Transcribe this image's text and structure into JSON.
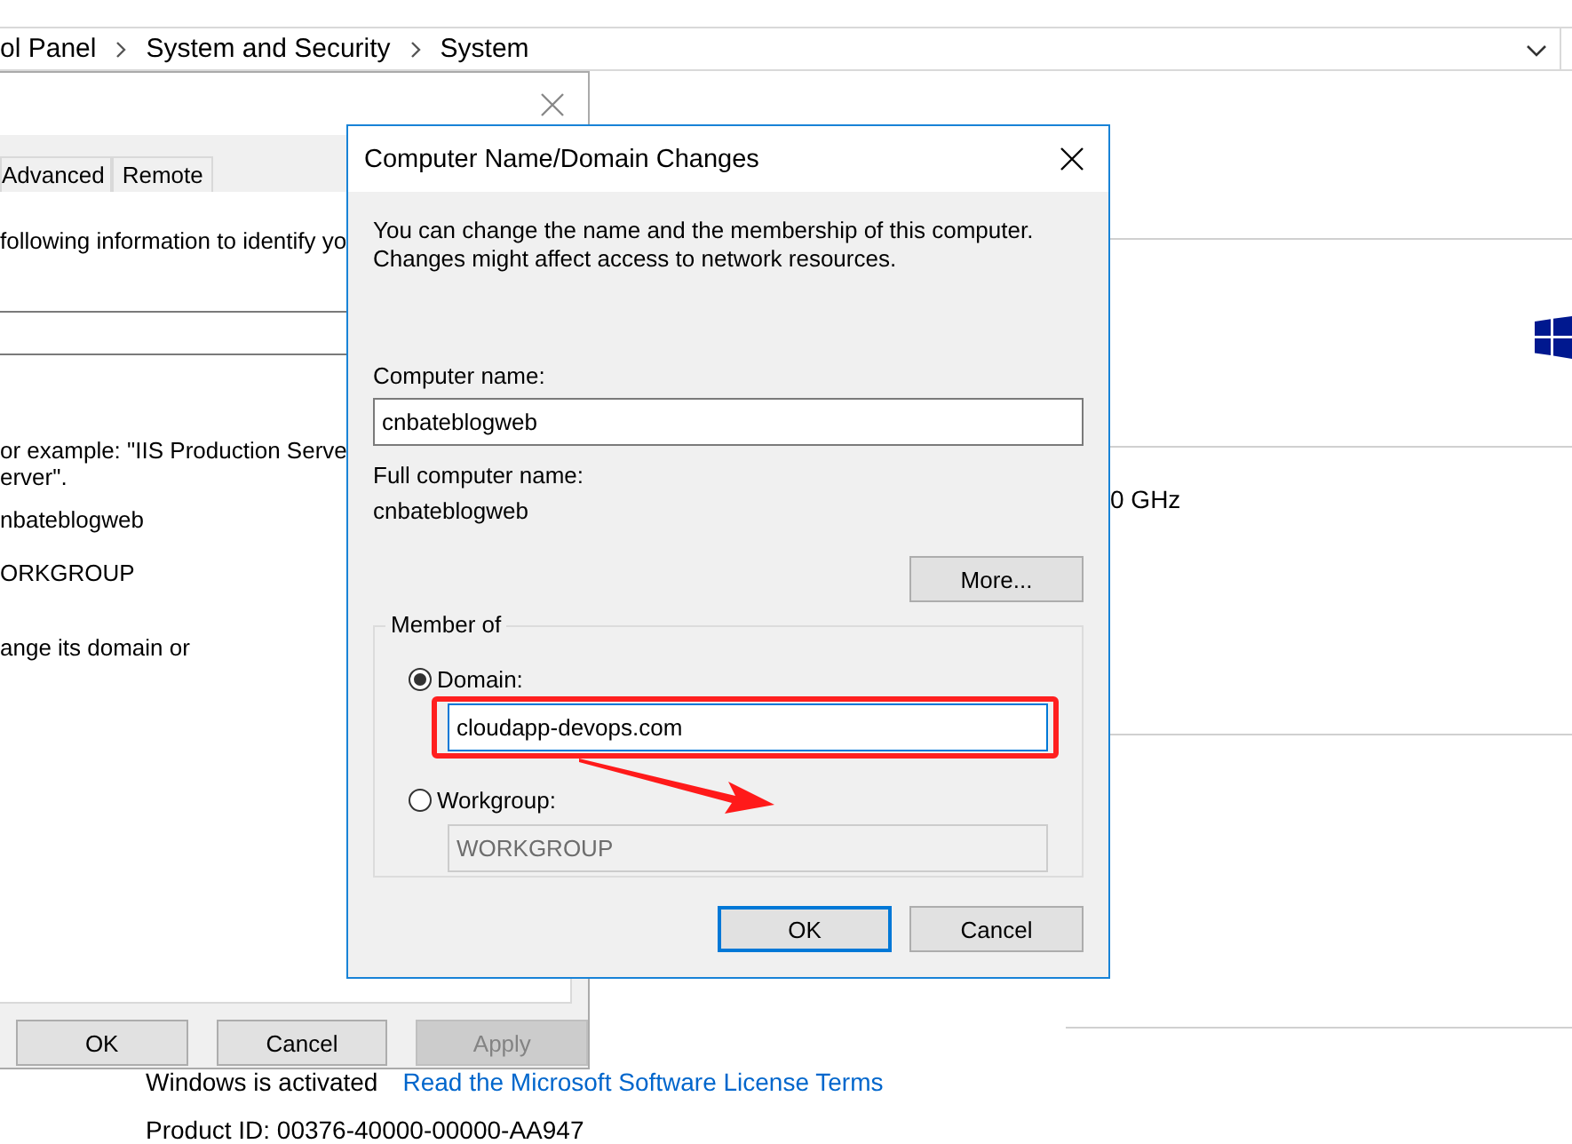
{
  "control_panel": {
    "breadcrumb": [
      "ol Panel",
      "System and Security",
      "System"
    ],
    "processor_fragment": "0 GHz",
    "activation_status": "Windows is activated",
    "license_link": "Read the Microsoft Software License Terms",
    "product_id": "Product ID: 00376-40000-00000-AA947"
  },
  "system_properties": {
    "tabs": [
      {
        "label": "Advanced",
        "selected": false
      },
      {
        "label": "Remote",
        "selected": false
      }
    ],
    "texts": [
      "following information to identify yo",
      "or example: \"IIS Production Serve",
      "erver\".",
      "nbateblogweb",
      "ORKGROUP",
      "ange its domain or"
    ],
    "buttons": [
      {
        "label": "OK",
        "disabled": false
      },
      {
        "label": "Cancel",
        "disabled": false
      },
      {
        "label": "Apply",
        "disabled": true
      }
    ]
  },
  "dialog": {
    "title": "Computer Name/Domain Changes",
    "intro_lines": [
      "You can change the name and the membership of this computer.",
      "Changes might affect access to network resources."
    ],
    "computer_name_label": "Computer name:",
    "computer_name": "cnbateblogweb",
    "full_name_label": "Full computer name:",
    "full_name": "cnbateblogweb",
    "more_button": "More...",
    "member_of": "Member of",
    "options": [
      {
        "label": "Domain:",
        "selected": true,
        "value": "cloudapp-devops.com"
      },
      {
        "label": "Workgroup:",
        "selected": false,
        "value": "WORKGROUP"
      }
    ],
    "buttons": [
      {
        "label": "OK",
        "default": true
      },
      {
        "label": "Cancel",
        "default": false
      }
    ]
  }
}
